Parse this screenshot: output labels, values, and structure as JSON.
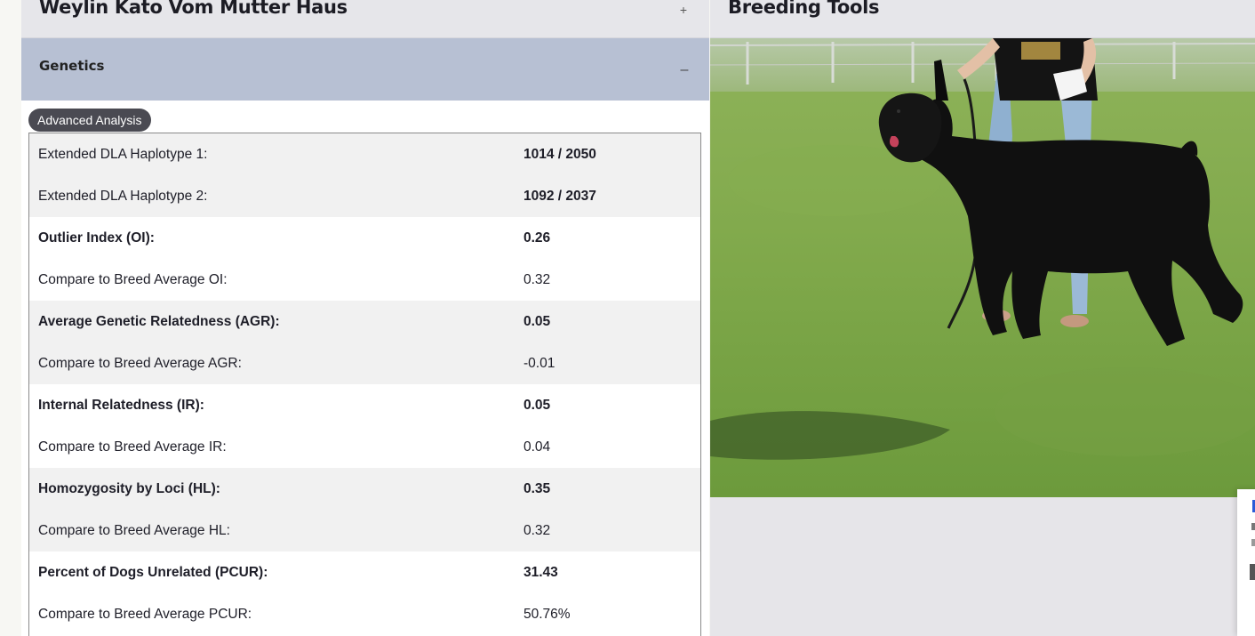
{
  "left_panel": {
    "title": "Weylin Kato Vom Mutter Haus",
    "expand_symbol": "+",
    "section": {
      "label": "Genetics",
      "collapse_symbol": "–"
    },
    "advanced_button": "Advanced Analysis",
    "rows": [
      {
        "label": "Extended DLA Haplotype 1:",
        "value": "1014 / 2050"
      },
      {
        "label": "Extended DLA Haplotype 2:",
        "value": "1092 / 2037"
      },
      {
        "label": "Outlier Index (OI):",
        "value": "0.26"
      },
      {
        "label": "Compare to Breed Average OI:",
        "value": "0.32"
      },
      {
        "label": "Average Genetic Relatedness (AGR):",
        "value": "0.05"
      },
      {
        "label": "Compare to Breed Average AGR:",
        "value": "-0.01"
      },
      {
        "label": "Internal Relatedness (IR):",
        "value": "0.05"
      },
      {
        "label": "Compare to Breed Average IR:",
        "value": "0.04"
      },
      {
        "label": "Homozygosity by Loci (HL):",
        "value": "0.35"
      },
      {
        "label": "Compare to Breed Average HL:",
        "value": "0.32"
      },
      {
        "label": "Percent of Dogs Unrelated (PCUR):",
        "value": "31.43"
      },
      {
        "label": "Compare to Breed Average PCUR:",
        "value": "50.76%"
      }
    ]
  },
  "right_panel": {
    "title": "Breeding Tools"
  }
}
